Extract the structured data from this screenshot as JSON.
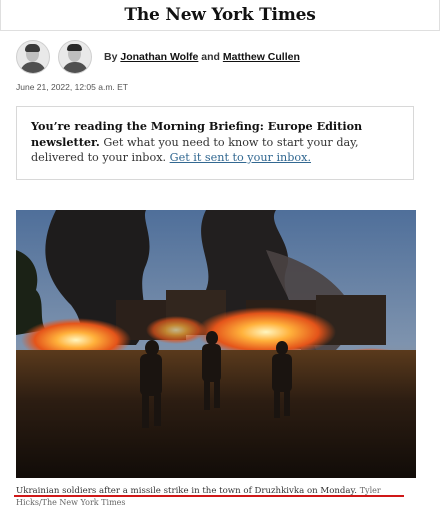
{
  "masthead": {
    "logo_text": "The New York Times"
  },
  "byline": {
    "by": "By",
    "author1": "Jonathan Wolfe",
    "and": "and",
    "author2": "Matthew Cullen"
  },
  "dateline": "June 21, 2022, 12:05 a.m. ET",
  "newsletter": {
    "lead": "You’re reading the Morning Briefing: Europe Edition newsletter.",
    "body": "Get what you need to know to start your day, delivered to your inbox.",
    "link": "Get it sent to your inbox."
  },
  "photo": {
    "caption": "Ukrainian soldiers after a missile strike in the town of Druzhkivka on Monday.",
    "credit": "Tyler Hicks/The New York Times"
  },
  "colors": {
    "link": "#326891",
    "annotation": "#d01818",
    "fire": "#ff7a1a"
  }
}
